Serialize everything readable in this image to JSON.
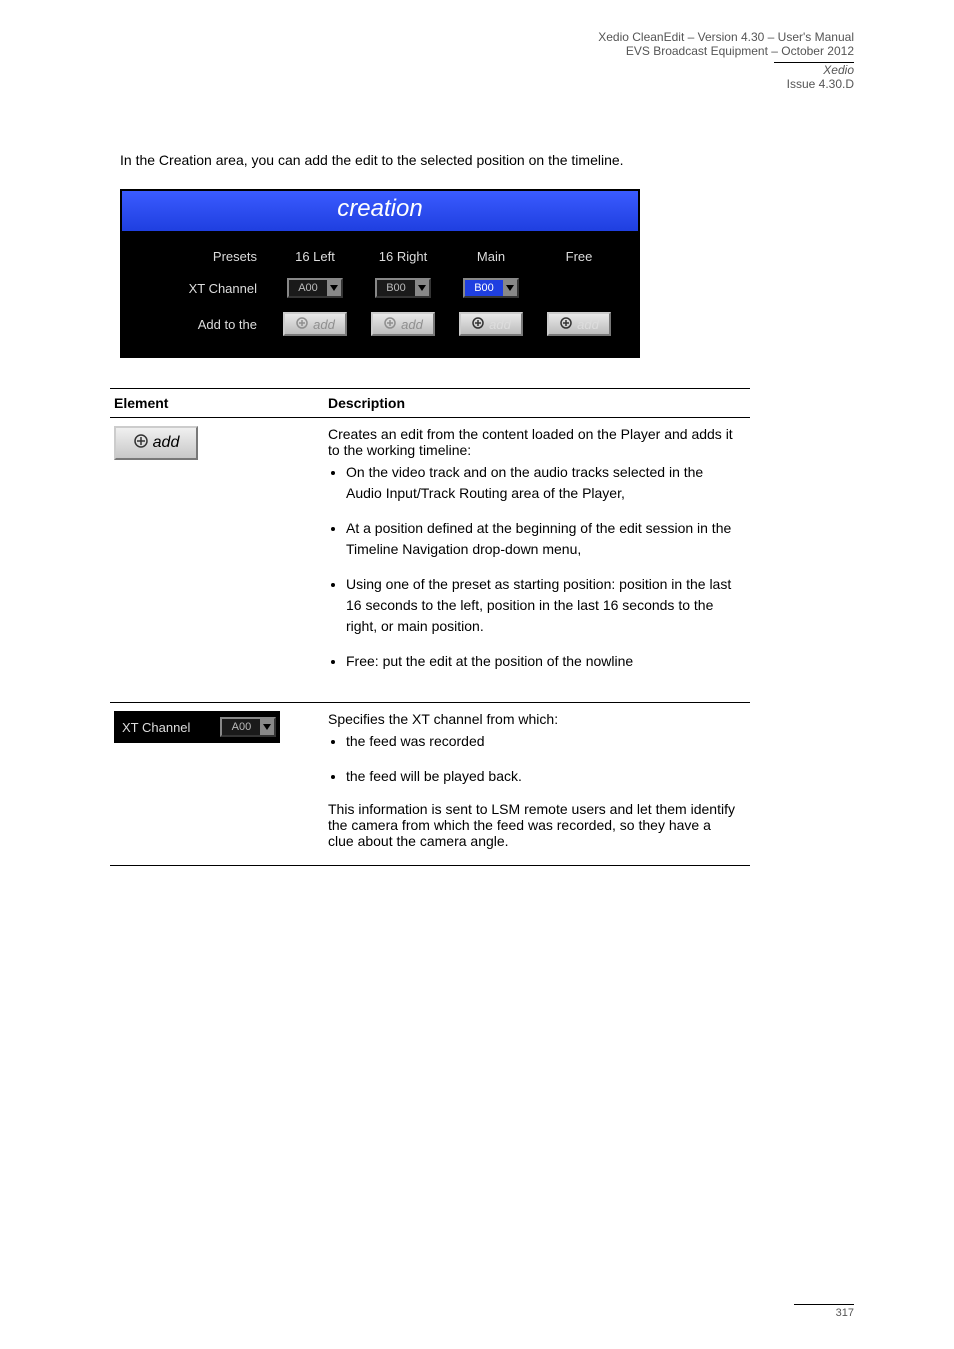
{
  "header": {
    "line1": "Xedio CleanEdit – Version 4.30 – User's Manual",
    "line2": "EVS Broadcast Equipment – October 2012",
    "product": "Xedio",
    "issue": "Issue 4.30.D"
  },
  "intro_text": "In the Creation area, you can add the edit to the selected position on the timeline.",
  "panel": {
    "title": "creation",
    "row_labels": {
      "presets": "Presets",
      "xtchannel": "XT Channel",
      "addto": "Add to the"
    },
    "columns": [
      "16 Left",
      "16 Right",
      "Main",
      "Free"
    ],
    "xt_values": [
      "A00",
      "B00",
      "B00"
    ],
    "xt_highlight_index": 2,
    "add_label": "add",
    "add_disabled": [
      true,
      true,
      false,
      false
    ]
  },
  "table": {
    "head": [
      "Element",
      "Description"
    ],
    "row_add": {
      "btn_label": "add",
      "intro": "Creates an edit from the content loaded on the Player and adds it to the working timeline:",
      "bullets": [
        "On the video track and on the audio tracks selected in the Audio Input/Track Routing area of the Player,",
        "At a position defined at the beginning of the edit session in the Timeline Navigation drop-down menu,",
        "Using one of the preset as starting position: position in the last 16 seconds to the left, position in the last 16 seconds to the right, or main position.",
        "Free: put the edit at the position of the nowline"
      ]
    },
    "row_xt": {
      "label": "XT Channel",
      "value": "A00",
      "intro": "Specifies the XT channel from which:",
      "bullets": [
        "the feed was recorded",
        "the feed will be played back."
      ],
      "outro": "This information is sent to LSM remote users and let them identify the camera from which the feed was recorded, so they have a clue about the camera angle."
    }
  },
  "footer": {
    "page": "317"
  }
}
